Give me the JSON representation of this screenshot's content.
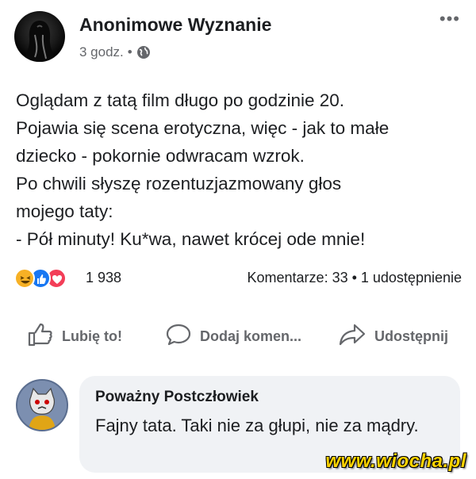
{
  "post": {
    "page_name": "Anonimowe Wyznanie",
    "time": "3 godz.",
    "separator": "•",
    "more_label": "•••",
    "text": "Oglądam z tatą film długo po godzinie 20.\nPojawia się scena erotyczna, więc - jak to małe\ndziecko - pokornie odwracam wzrok.\nPo chwili słyszę rozentuzjazmowany głos\nmojego taty:\n- Pół minuty! Ku*wa, nawet krócej ode mnie!"
  },
  "stats": {
    "reactions": [
      "haha",
      "like",
      "love"
    ],
    "reaction_count": "1 938",
    "comments_shares": "Komentarze: 33 • 1 udostępnienie"
  },
  "actions": {
    "like": "Lubię to!",
    "comment": "Dodaj komen...",
    "share": "Udostępnij"
  },
  "comment": {
    "author": "Poważny Postczłowiek",
    "text": "Fajny tata. Taki nie za głupi, nie za mądry."
  },
  "watermark": "www.wiocha.pl",
  "colors": {
    "text": "#1c1e21",
    "secondary": "#65676b",
    "like_blue": "#1877f2",
    "love_red": "#f33e58",
    "haha_yellow": "#f7b125",
    "bubble": "#f0f2f5"
  }
}
